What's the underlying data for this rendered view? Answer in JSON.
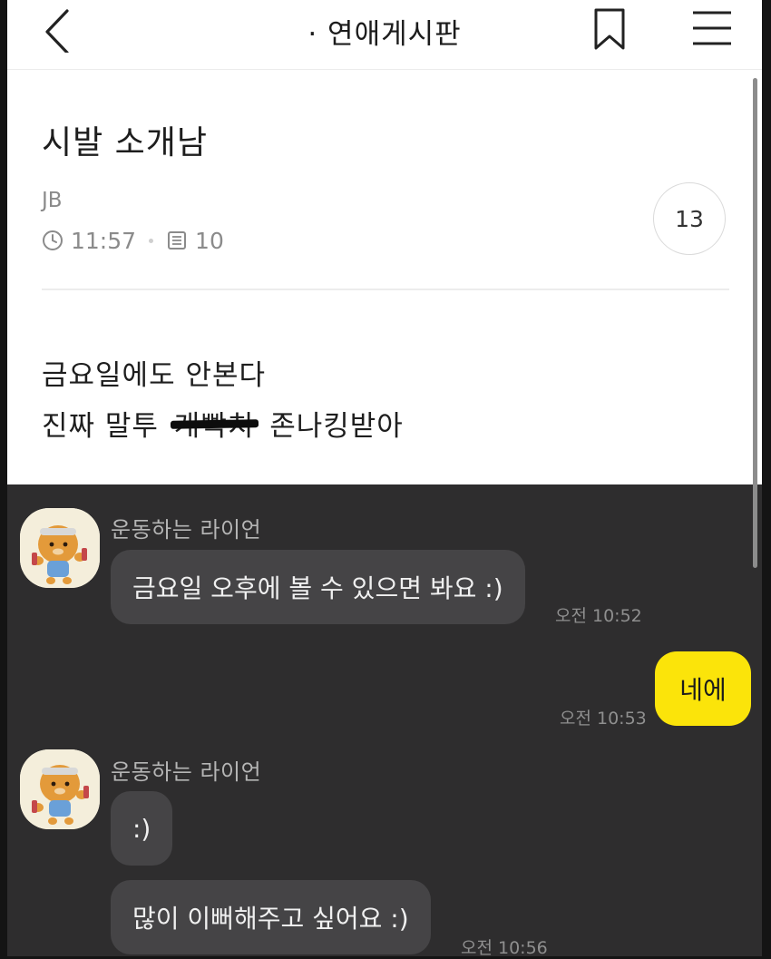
{
  "header": {
    "title": "· 연애게시판",
    "back_icon": "chevron-left-icon",
    "bookmark_icon": "bookmark-icon",
    "menu_icon": "hamburger-menu-icon"
  },
  "post": {
    "title": "시발 소개남",
    "author": "JB",
    "time": "11:57",
    "views": "10",
    "comment_count": "13",
    "body_line1": "금요일에도 안본다",
    "body_line2_before": "진짜 말투",
    "body_line2_struck": "개빡치",
    "body_line2_after": "존나킹받아"
  },
  "chat": {
    "messages": [
      {
        "sender": "운동하는 라이언",
        "text": "금요일 오후에 볼 수 있으면 봐요 :)",
        "time": "오전 10:52"
      },
      {
        "sender": "me",
        "text": "네에",
        "time": "오전 10:53"
      },
      {
        "sender": "운동하는 라이언",
        "text": ":)"
      },
      {
        "sender": "운동하는 라이언",
        "text": "많이 이뻐해주고 싶어요 :)",
        "time": "오전 10:56"
      }
    ]
  },
  "colors": {
    "chat_background": "#2e2d2e",
    "incoming_bubble": "#454446",
    "outgoing_bubble": "#fbe40a"
  }
}
